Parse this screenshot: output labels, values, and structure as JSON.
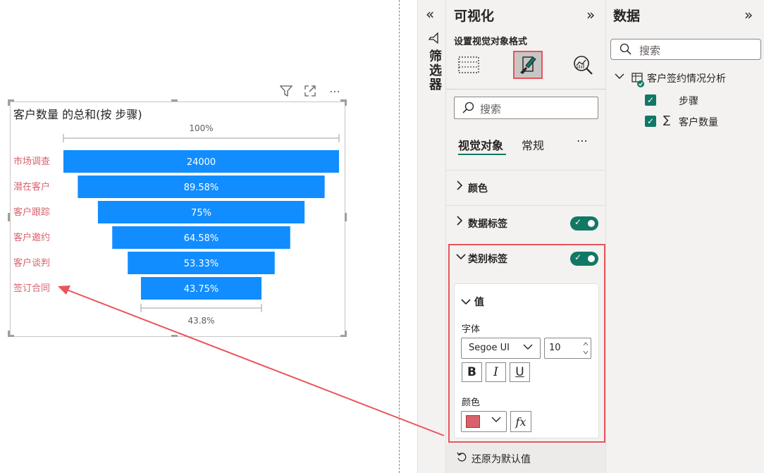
{
  "canvas": {
    "header_icons": [
      "filter-icon",
      "focus-mode-icon",
      "more-options-icon"
    ],
    "more_label": "⋯"
  },
  "chart_data": {
    "type": "funnel",
    "title": "客户数量 的总和(按 步骤)",
    "categories": [
      "市场调查",
      "潜在客户",
      "客户跟踪",
      "客户邀约",
      "客户谈判",
      "签订合同"
    ],
    "values": [
      24000,
      21500,
      18000,
      15500,
      12800,
      10500
    ],
    "data_labels": [
      "24000",
      "89.58%",
      "75%",
      "64.58%",
      "53.33%",
      "43.75%"
    ],
    "top_percent_label": "100%",
    "bottom_percent_label": "43.8%",
    "bar_color": "#118dff",
    "category_label_color": "#d7626d"
  },
  "filter_pane": {
    "collapse_glyph": "«",
    "label": "筛选器"
  },
  "viz_pane": {
    "title": "可视化",
    "expand_glyph": "»",
    "subtitle": "设置视觉对象格式",
    "search_placeholder": "搜索",
    "tabs": [
      "视觉对象",
      "常规"
    ],
    "more_glyph": "⋯",
    "sections": [
      {
        "label": "颜色",
        "expanded": false,
        "has_toggle": false
      },
      {
        "label": "数据标签",
        "expanded": false,
        "has_toggle": true,
        "toggle_on": true
      },
      {
        "label": "类别标签",
        "expanded": true,
        "has_toggle": true,
        "toggle_on": true
      }
    ],
    "value_card": {
      "header": "值",
      "font_label": "字体",
      "font_family": "Segoe UI",
      "font_size": "10",
      "bold": "B",
      "italic": "I",
      "underline": "U",
      "color_label": "颜色",
      "color_value": "#d7626d",
      "fx": "fx"
    },
    "reset_label": "还原为默认值",
    "accent_color": "#117865",
    "highlight_color": "#e9545b"
  },
  "data_pane": {
    "title": "数据",
    "expand_glyph": "»",
    "search_placeholder": "搜索",
    "table_name": "客户签约情况分析",
    "fields": [
      {
        "name": "步骤",
        "checked": true,
        "sigma": false
      },
      {
        "name": "客户数量",
        "checked": true,
        "sigma": true
      }
    ]
  }
}
